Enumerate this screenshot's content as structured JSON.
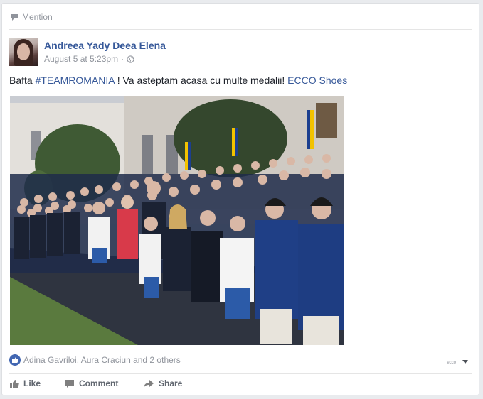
{
  "mention_label": "Mention",
  "post": {
    "author": "Andreea Yady Deea Elena",
    "timestamp": "August 5 at 5:23pm",
    "separator": "·",
    "text_prefix": "Bafta ",
    "hashtag": "#TEAMROMANIA",
    "text_middle": " ! Va asteptam acasa cu multe medalii! ",
    "tagged_page": "ECCO Shoes"
  },
  "reactions": {
    "summary": "Adina Gavriloi, Aura Craciun and 2 others",
    "page_tag": "ecco"
  },
  "actions": {
    "like": "Like",
    "comment": "Comment",
    "share": "Share"
  },
  "colors": {
    "link": "#365899",
    "muted": "#90949c",
    "like_blue": "#4267b2"
  }
}
